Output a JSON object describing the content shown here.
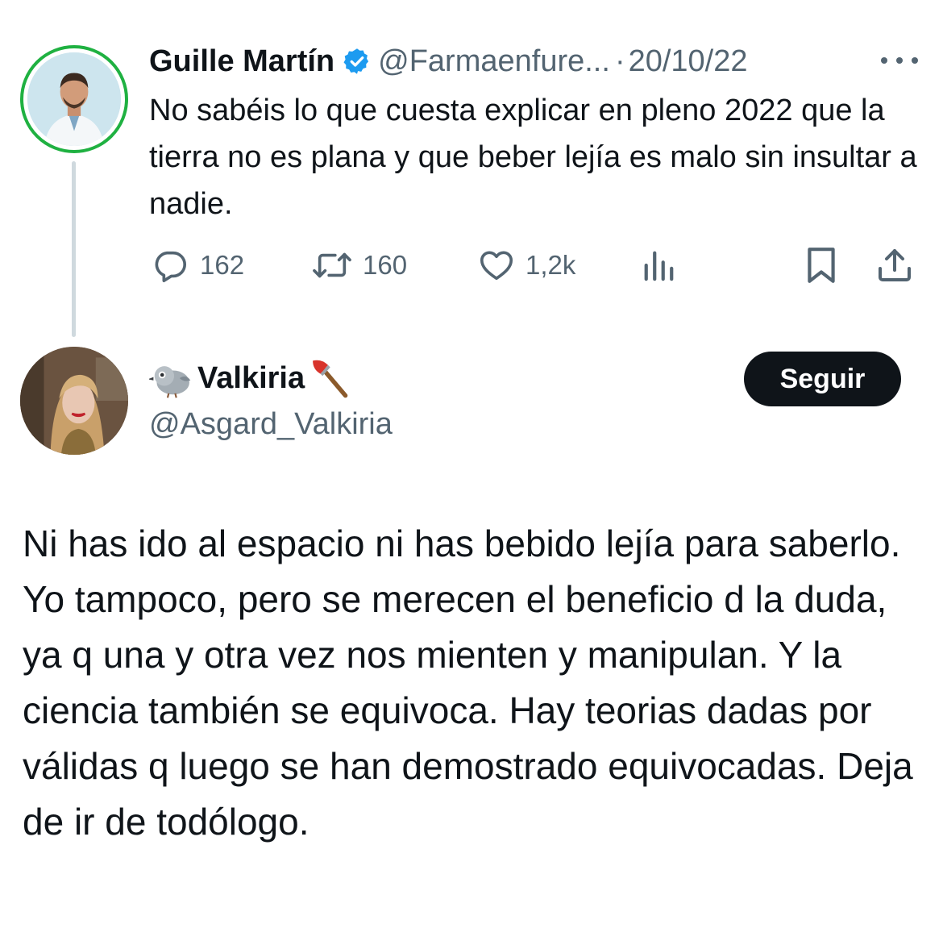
{
  "parent_tweet": {
    "author_name": "Guille Martín",
    "handle": "@Farmaenfure...",
    "separator": "·",
    "date": "20/10/22",
    "text": "No sabéis lo que cuesta explicar en pleno 2022 que la tierra no es plana y que beber lejía es malo sin insultar a nadie.",
    "verified_icon": "verified-badge-icon",
    "metrics": {
      "replies": "162",
      "retweets": "160",
      "likes": "1,2k"
    }
  },
  "reply_tweet": {
    "author_name": "Valkiria",
    "handle": "@Asgard_Valkiria",
    "follow_label": "Seguir",
    "name_emojis": [
      "bird-emoji",
      "axe-emoji"
    ],
    "text": "Ni has ido al espacio ni has bebido lejía para saberlo. Yo tampoco, pero se merecen el beneficio d la duda, ya q una y otra vez nos mienten y manipulan. Y la ciencia también se equivoca. Hay teorias dadas por válidas q luego se han demostrado equivocadas. Deja de ir de todólogo."
  },
  "colors": {
    "text_primary": "#0f1419",
    "text_secondary": "#536471",
    "verified_blue": "#1d9bf0",
    "avatar_ring_green": "#1fb141",
    "thread_line": "#cfd9de",
    "follow_button_bg": "#0f1419"
  }
}
